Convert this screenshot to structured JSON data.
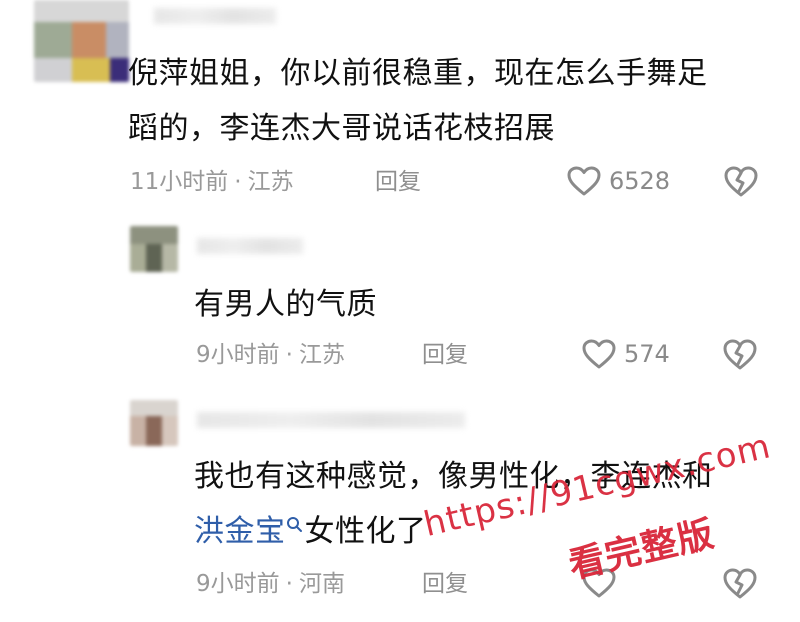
{
  "comments": [
    {
      "text_line1": "倪萍姐姐，你以前很稳重，现在怎么手舞足",
      "text_line2": "蹈的，李连杰大哥说话花枝招展",
      "time": "11小时前",
      "location": "江苏",
      "reply_label": "回复",
      "likes": "6528"
    },
    {
      "text_line1": "有男人的气质",
      "time": "9小时前",
      "location": "江苏",
      "reply_label": "回复",
      "likes": "574"
    },
    {
      "text_line1": "我也有这种感觉，像男性化，李连杰和",
      "topic": "洪金宝",
      "text_line2_rest": "女性化了",
      "time": "9小时前",
      "location": "河南",
      "reply_label": "回复"
    }
  ],
  "watermark": {
    "url": "https://91cgwx.com",
    "tag": "看完整版"
  },
  "colors": {
    "meta_gray": "#999999",
    "topic_blue": "#2f5ea9",
    "watermark_red": "#d9283b"
  },
  "icons": {
    "like": "heart-outline",
    "dislike": "broken-heart-outline",
    "topic_search": "search-icon"
  }
}
